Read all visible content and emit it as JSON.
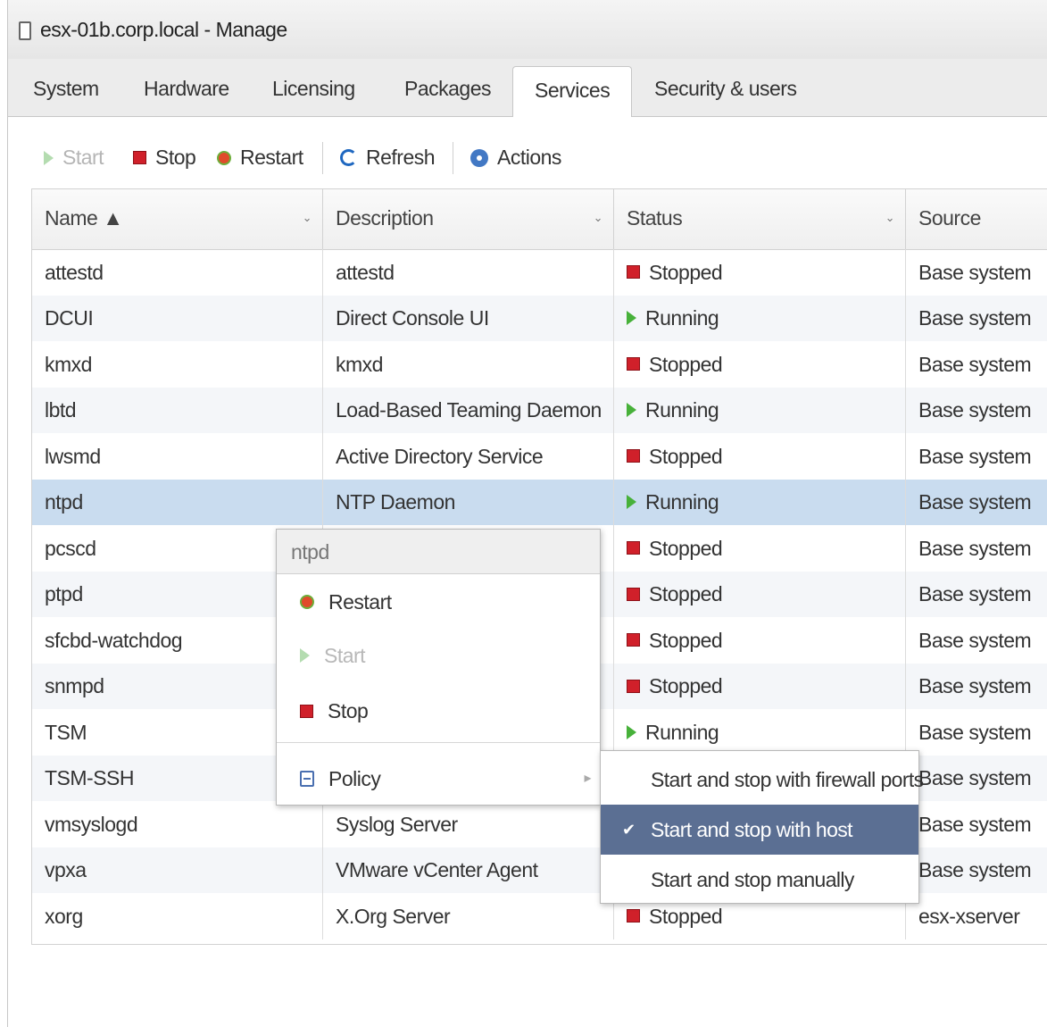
{
  "window": {
    "title": "esx-01b.corp.local - Manage"
  },
  "tabs": [
    {
      "label": "System"
    },
    {
      "label": "Hardware"
    },
    {
      "label": "Licensing"
    },
    {
      "label": "Packages"
    },
    {
      "label": "Services"
    },
    {
      "label": "Security & users"
    }
  ],
  "active_tab": "Services",
  "toolbar": {
    "start": "Start",
    "stop": "Stop",
    "restart": "Restart",
    "refresh": "Refresh",
    "actions": "Actions"
  },
  "table": {
    "columns": [
      "Name ▲",
      "Description",
      "Status",
      "Source"
    ],
    "rows": [
      {
        "name": "attestd",
        "description": "attestd",
        "status": "Stopped",
        "source": "Base system"
      },
      {
        "name": "DCUI",
        "description": "Direct Console UI",
        "status": "Running",
        "source": "Base system"
      },
      {
        "name": "kmxd",
        "description": "kmxd",
        "status": "Stopped",
        "source": "Base system"
      },
      {
        "name": "lbtd",
        "description": "Load-Based Teaming Daemon",
        "status": "Running",
        "source": "Base system"
      },
      {
        "name": "lwsmd",
        "description": "Active Directory Service",
        "status": "Stopped",
        "source": "Base system"
      },
      {
        "name": "ntpd",
        "description": "NTP Daemon",
        "status": "Running",
        "source": "Base system"
      },
      {
        "name": "pcscd",
        "description": "",
        "status": "Stopped",
        "source": "Base system"
      },
      {
        "name": "ptpd",
        "description": "",
        "status": "Stopped",
        "source": "Base system"
      },
      {
        "name": "sfcbd-watchdog",
        "description": "",
        "status": "Stopped",
        "source": "Base system"
      },
      {
        "name": "snmpd",
        "description": "",
        "status": "Stopped",
        "source": "Base system"
      },
      {
        "name": "TSM",
        "description": "",
        "status": "Running",
        "source": "Base system"
      },
      {
        "name": "TSM-SSH",
        "description": "",
        "status": "",
        "source": "Base system"
      },
      {
        "name": "vmsyslogd",
        "description": "Syslog Server",
        "status": "",
        "source": "Base system"
      },
      {
        "name": "vpxa",
        "description": "VMware vCenter Agent",
        "status": "",
        "source": "Base system"
      },
      {
        "name": "xorg",
        "description": "X.Org Server",
        "status": "Stopped",
        "source": "esx-xserver"
      }
    ],
    "selected_row": "ntpd"
  },
  "context_menu": {
    "header": "ntpd",
    "restart": "Restart",
    "start": "Start",
    "stop": "Stop",
    "policy": "Policy"
  },
  "policy_submenu": {
    "items": [
      "Start and stop with firewall ports",
      "Start and stop with host",
      "Start and stop manually"
    ],
    "selected": "Start and stop with host"
  },
  "colors": {
    "stopped_icon": "#d0202a",
    "running_icon": "#47b13a",
    "selected_row": "#c9dcef",
    "submenu_selected": "#5b6f93"
  }
}
